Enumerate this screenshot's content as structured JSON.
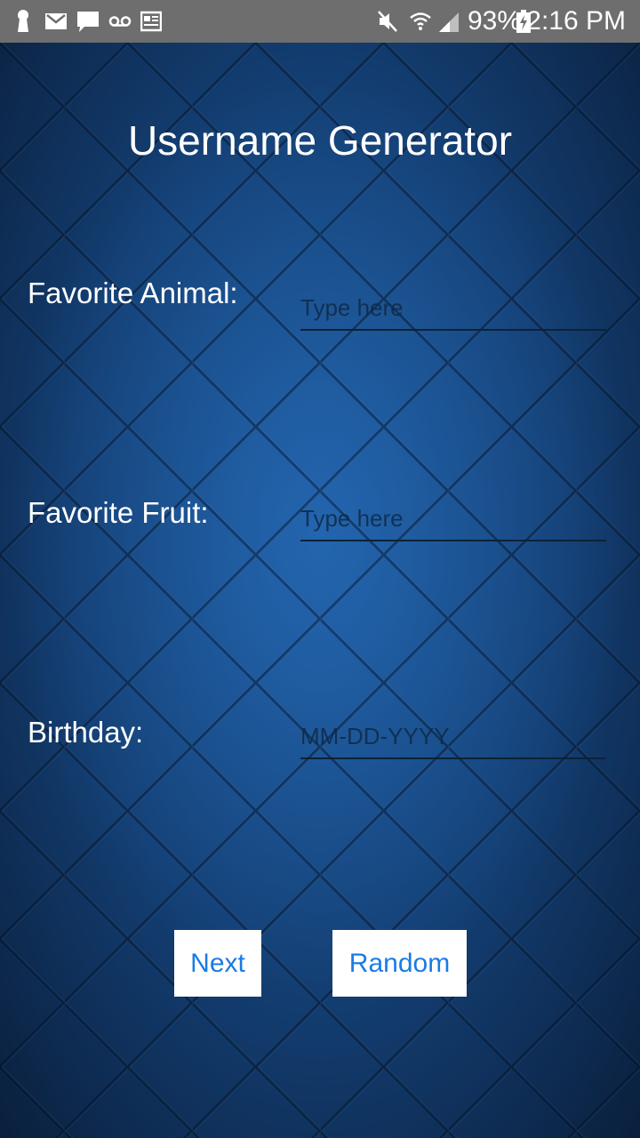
{
  "status_bar": {
    "battery_percent": "93%",
    "time": "2:16 PM",
    "icons_left": [
      "keyhole-icon",
      "mail-icon",
      "chat-icon",
      "voicemail-icon",
      "news-icon"
    ],
    "icons_right": [
      "mute-icon",
      "wifi-icon",
      "signal-icon",
      "battery-charging-icon"
    ]
  },
  "screen": {
    "title": "Username Generator",
    "fields": [
      {
        "label": "Favorite Animal:",
        "placeholder": "Type here",
        "value": ""
      },
      {
        "label": "Favorite Fruit:",
        "placeholder": "Type here",
        "value": ""
      },
      {
        "label": "Birthday:",
        "placeholder": "MM-DD-YYYY",
        "value": ""
      }
    ],
    "buttons": {
      "next": "Next",
      "random": "Random"
    }
  },
  "colors": {
    "status_bar_bg": "#6e6e6e",
    "background_center": "#1d5a9c",
    "background_edge": "#0a1f3c",
    "button_bg": "#ffffff",
    "button_text": "#1a7be6"
  }
}
